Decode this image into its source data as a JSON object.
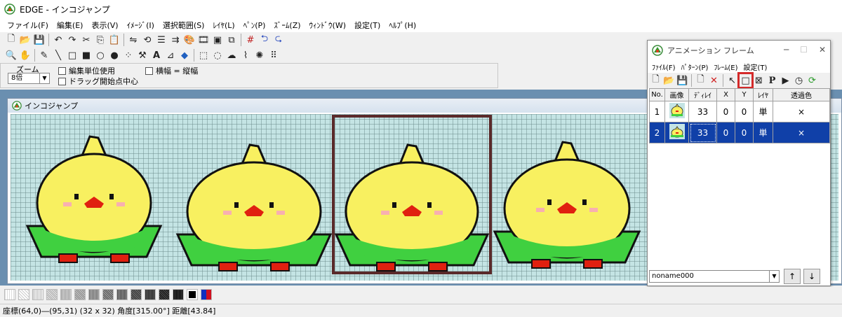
{
  "app": {
    "title": "EDGE - インコジャンプ"
  },
  "menu": [
    "ファイル(F)",
    "編集(E)",
    "表示(V)",
    "ｲﾒｰｼﾞ(I)",
    "選択範囲(S)",
    "ﾚｲﾔ(L)",
    "ﾍﾟﾝ(P)",
    "ｽﾞｰﾑ(Z)",
    "ｳｨﾝﾄﾞｳ(W)",
    "設定(T)",
    "ﾍﾙﾌﾟ(H)"
  ],
  "options": {
    "zoom_label": "ズーム",
    "zoom_value": "8倍",
    "edit_unit": "編集単位使用",
    "drag_center": "ドラッグ開始点中心",
    "width_eq_height": "横幅 = 縦幅"
  },
  "child_window": {
    "title": "インコジャンプ"
  },
  "anim_window": {
    "title": "アニメーション フレーム",
    "menu": [
      "ﾌｧｲﾙ(F)",
      "ﾊﾟﾀｰﾝ(P)",
      "ﾌﾚｰﾑ(E)",
      "設定(T)"
    ],
    "columns": [
      "No.",
      "画像",
      "ﾃﾞｨﾚｲ",
      "X",
      "Y",
      "ﾚｲﾔ",
      "透過色"
    ],
    "rows": [
      {
        "no": "1",
        "delay": "33",
        "x": "0",
        "y": "0",
        "layer": "単",
        "transparent": "×"
      },
      {
        "no": "2",
        "delay": "33",
        "x": "0",
        "y": "0",
        "layer": "単",
        "transparent": "×"
      }
    ],
    "selected_row": 2,
    "name_value": "noname000",
    "up_label": "↑",
    "down_label": "↓"
  },
  "status": {
    "coords": "座標(64,0)―(95,31)",
    "size": "(32 x 32)",
    "angle": "角度[315.00°]",
    "distance": "距離[43.84]"
  },
  "colors": {
    "selection": "#1040a8",
    "highlight_box": "#d42a2a",
    "sprite_yellow": "#f8f060",
    "sprite_green": "#40d040",
    "sprite_red": "#e02010",
    "sprite_pink": "#f8b0b0",
    "canvas_bg": "#c4e4e4"
  }
}
